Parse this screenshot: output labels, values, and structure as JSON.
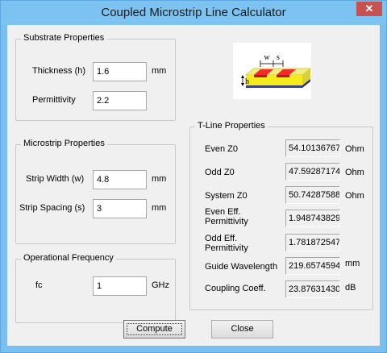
{
  "window": {
    "title": "Coupled Microstrip Line Calculator",
    "close_glyph": "✕"
  },
  "substrate": {
    "legend": "Substrate Properties",
    "thickness_label": "Thickness (h)",
    "thickness_value": "1.6",
    "thickness_unit": "mm",
    "permittivity_label": "Permittivity",
    "permittivity_value": "2.2"
  },
  "microstrip": {
    "legend": "Microstrip Properties",
    "width_label": "Strip Width (w)",
    "width_value": "4.8",
    "width_unit": "mm",
    "spacing_label": "Strip Spacing (s)",
    "spacing_value": "3",
    "spacing_unit": "mm"
  },
  "frequency": {
    "legend": "Operational Frequency",
    "fc_label": "fc",
    "fc_value": "1",
    "fc_unit": "GHz"
  },
  "diagram": {
    "w_label": "w",
    "s_label": "s",
    "h_label": "h"
  },
  "tline": {
    "legend": "T-Line Properties",
    "rows": [
      {
        "label": "Even Z0",
        "value": "54.10136767",
        "unit": "Ohm"
      },
      {
        "label": "Odd Z0",
        "value": "47.59287174",
        "unit": "Ohm"
      },
      {
        "label": "System Z0",
        "value": "50.74287588",
        "unit": "Ohm"
      },
      {
        "label_l1": "Even Eff.",
        "label_l2": "Permittivity",
        "value": "1.948743829",
        "unit": ""
      },
      {
        "label_l1": "Odd Eff.",
        "label_l2": "Permittivity",
        "value": "1.781872547",
        "unit": ""
      },
      {
        "label": "Guide Wavelength",
        "value": "219.6574594",
        "unit": "mm"
      },
      {
        "label": "Coupling Coeff.",
        "value": "23.87631430",
        "unit": "dB"
      }
    ]
  },
  "buttons": {
    "compute": "Compute",
    "close": "Close"
  }
}
